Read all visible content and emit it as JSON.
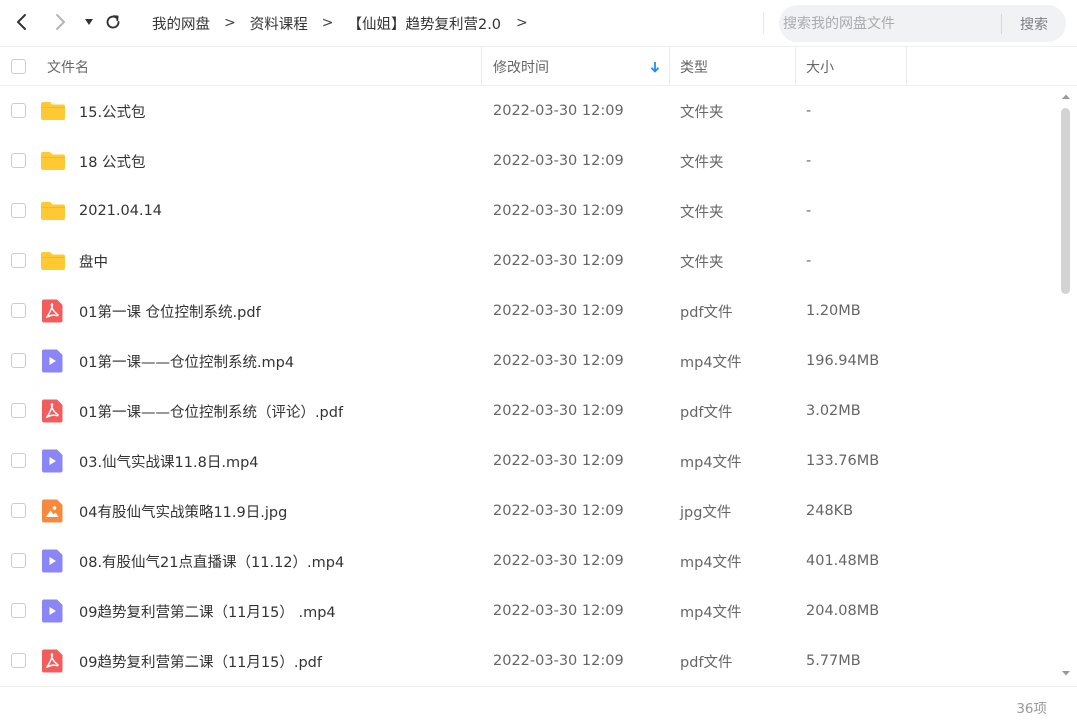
{
  "nav": {
    "breadcrumbs": [
      "我的网盘",
      "资料课程",
      "【仙姐】趋势复利营2.0"
    ],
    "sep": ">"
  },
  "search": {
    "placeholder": "搜索我的网盘文件",
    "button": "搜索"
  },
  "table": {
    "columns": {
      "name": "文件名",
      "modified": "修改时间",
      "type": "类型",
      "size": "大小"
    },
    "sort": "modified-desc",
    "rows": [
      {
        "name": "15.公式包",
        "modified": "2022-03-30 12:09",
        "type": "文件夹",
        "size": "-",
        "icon": "folder-icon"
      },
      {
        "name": "18 公式包",
        "modified": "2022-03-30 12:09",
        "type": "文件夹",
        "size": "-",
        "icon": "folder-icon"
      },
      {
        "name": "2021.04.14",
        "modified": "2022-03-30 12:09",
        "type": "文件夹",
        "size": "-",
        "icon": "folder-icon"
      },
      {
        "name": "盘中",
        "modified": "2022-03-30 12:09",
        "type": "文件夹",
        "size": "-",
        "icon": "folder-icon"
      },
      {
        "name": "01第一课 仓位控制系统.pdf",
        "modified": "2022-03-30 12:09",
        "type": "pdf文件",
        "size": "1.20MB",
        "icon": "pdf-icon"
      },
      {
        "name": "01第一课——仓位控制系统.mp4",
        "modified": "2022-03-30 12:09",
        "type": "mp4文件",
        "size": "196.94MB",
        "icon": "video-icon"
      },
      {
        "name": "01第一课——仓位控制系统（评论）.pdf",
        "modified": "2022-03-30 12:09",
        "type": "pdf文件",
        "size": "3.02MB",
        "icon": "pdf-icon"
      },
      {
        "name": "03.仙气实战课11.8日.mp4",
        "modified": "2022-03-30 12:09",
        "type": "mp4文件",
        "size": "133.76MB",
        "icon": "video-icon"
      },
      {
        "name": "04有股仙气实战策略11.9日.jpg",
        "modified": "2022-03-30 12:09",
        "type": "jpg文件",
        "size": "248KB",
        "icon": "image-icon"
      },
      {
        "name": "08.有股仙气21点直播课（11.12）.mp4",
        "modified": "2022-03-30 12:09",
        "type": "mp4文件",
        "size": "401.48MB",
        "icon": "video-icon"
      },
      {
        "name": "09趋势复利营第二课（11月15） .mp4",
        "modified": "2022-03-30 12:09",
        "type": "mp4文件",
        "size": "204.08MB",
        "icon": "video-icon"
      },
      {
        "name": "09趋势复利营第二课（11月15）.pdf",
        "modified": "2022-03-30 12:09",
        "type": "pdf文件",
        "size": "5.77MB",
        "icon": "pdf-icon"
      }
    ]
  },
  "footer": {
    "count": "36项"
  },
  "colors": {
    "folder": "#ffc933",
    "pdf": "#f25c5c",
    "video": "#8a86f5",
    "image": "#f58a3c",
    "sort_arrow": "#1e8ef5"
  }
}
